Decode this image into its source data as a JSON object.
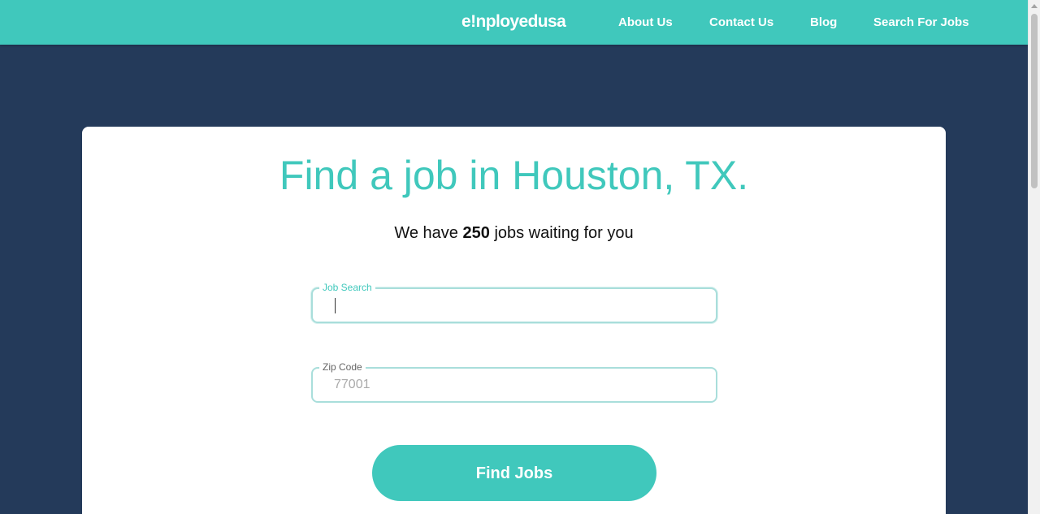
{
  "header": {
    "logo_prefix": "e",
    "logo_mark": "!",
    "logo_suffix": "nployedusa",
    "nav": [
      {
        "label": "About Us"
      },
      {
        "label": "Contact Us"
      },
      {
        "label": "Blog"
      },
      {
        "label": "Search For Jobs"
      }
    ]
  },
  "main": {
    "title": "Find a job in Houston, TX.",
    "subtitle_prefix": "We have",
    "job_count": "250",
    "subtitle_suffix": "jobs waiting for you",
    "job_search": {
      "label": "Job Search",
      "value": "",
      "placeholder": ""
    },
    "zip_code": {
      "label": "Zip Code",
      "value": "",
      "placeholder": "77001"
    },
    "find_button_label": "Find Jobs"
  },
  "colors": {
    "brand_teal": "#40c8bc",
    "page_navy": "#243a5a",
    "card_white": "#ffffff"
  }
}
